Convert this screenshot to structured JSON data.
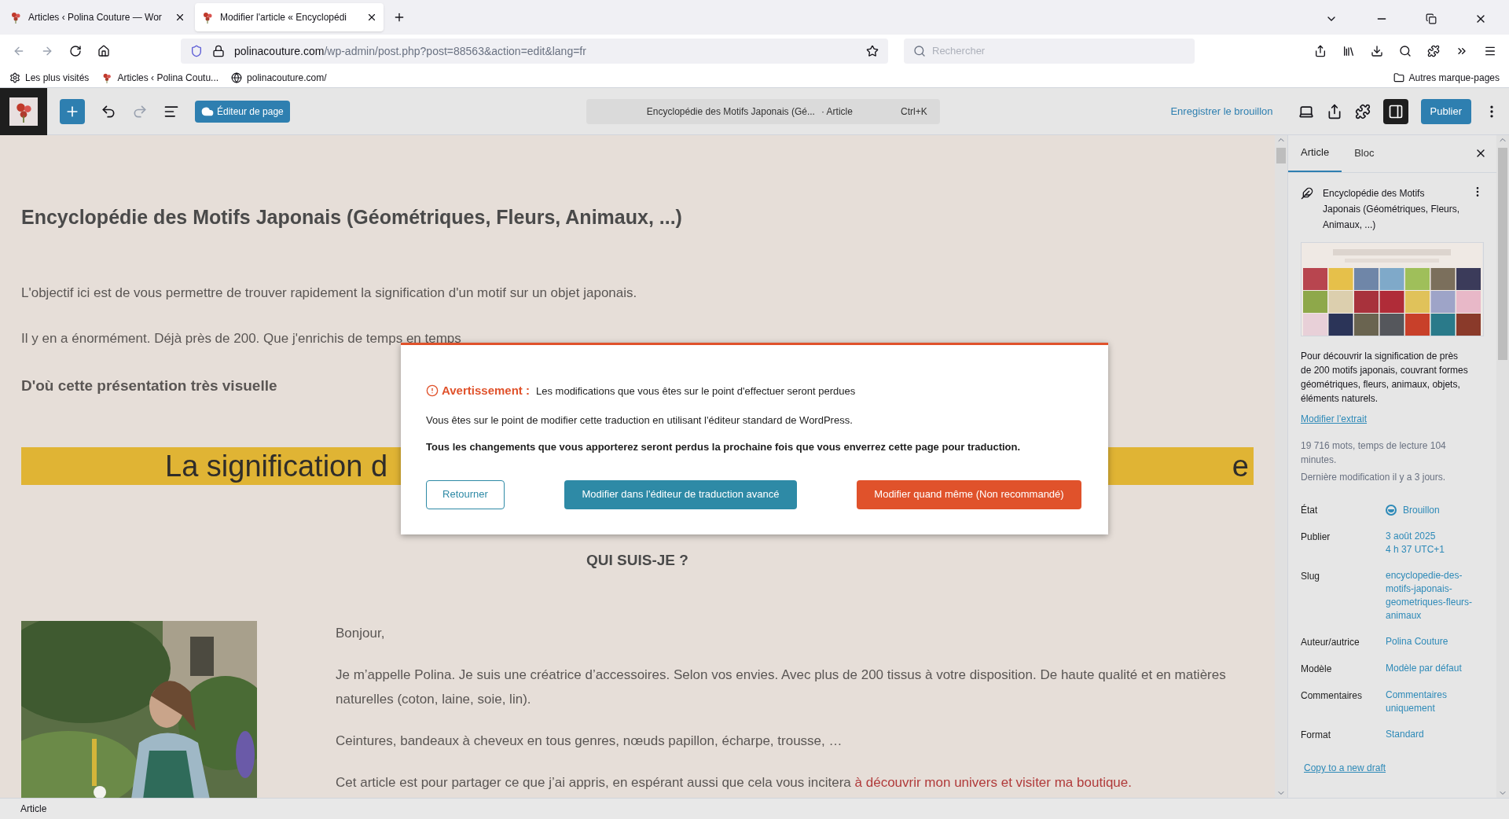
{
  "browser": {
    "tabs": [
      {
        "title": "Articles ‹ Polina Couture — Wor",
        "selected": false
      },
      {
        "title": "Modifier l'article « Encyclopédi",
        "selected": true
      }
    ],
    "url_host": "polinacouture.com",
    "url_path": "/wp-admin/post.php?post=88563&action=edit&lang=fr",
    "search_placeholder": "Rechercher",
    "bookmarks": [
      "Les plus visités",
      "Articles ‹ Polina Coutu...",
      "polinacouture.com/"
    ],
    "other_bookmarks": "Autres marque-pages"
  },
  "toolbar": {
    "editor_button": "Éditeur de page",
    "doc_title": "Encyclopédie des Motifs Japonais (Gé...",
    "doc_type": "· Article",
    "shortcut": "Ctrl+K",
    "save_draft": "Enregistrer le brouillon",
    "publish": "Publier"
  },
  "content": {
    "title": "Encyclopédie des Motifs Japonais (Géométriques, Fleurs, Animaux, ...)",
    "paragraphs": [
      {
        "text": "L'objectif ici est de vous permettre de trouver rapidement la signification d'un motif sur un objet japonais.",
        "bold": false
      },
      {
        "text": "Il y en a énormément. Déjà près de 200. Que j'enrichis de temps en temps",
        "bold": false
      },
      {
        "text": "D'où cette présentation très visuelle",
        "bold": true
      }
    ],
    "banner_left": "La signification d",
    "banner_right": "e",
    "section_heading": "QUI SUIS-JE ?",
    "bio": [
      "Bonjour,",
      "Je m’appelle Polina. Je suis une créatrice d’accessoires. Selon vos envies. Avec plus de 200 tissus à votre disposition. De haute qualité et en matières naturelles (coton, laine, soie, lin).",
      "Ceintures, bandeaux à cheveux en tous genres, nœuds papillon, écharpe, trousse, …"
    ],
    "bio_last": "Cet article est pour partager ce que j’ai appris, en espérant aussi que cela vous incitera ",
    "bio_link": "à découvrir mon univers et visiter ma boutique."
  },
  "sidebar": {
    "tabs": [
      {
        "label": "Article",
        "selected": true
      },
      {
        "label": "Bloc",
        "selected": false
      }
    ],
    "post_title": "Encyclopédie des Motifs Japonais (Géométriques, Fleurs, Animaux, ...)",
    "excerpt": "Pour découvrir la signification de près de 200 motifs japonais, couvrant formes géométriques, fleurs, animaux, objets, éléments naturels.",
    "edit_excerpt": "Modifier l’extrait",
    "stats": "19 716 mots, temps de lecture 104 minutes.",
    "modified": "Dernière modification il y a 3 jours.",
    "fields": [
      {
        "label": "État",
        "value": "Brouillon",
        "kind": "status"
      },
      {
        "label": "Publier",
        "value": "3 août 2025\n4 h 37 UTC+1",
        "kind": "link"
      },
      {
        "label": "Slug",
        "value": "encyclopedie-des-motifs-japonais-geometriques-fleurs-animaux",
        "kind": "link"
      },
      {
        "label": "Auteur/autrice",
        "value": "Polina Couture",
        "kind": "link"
      },
      {
        "label": "Modèle",
        "value": "Modèle par défaut",
        "kind": "link"
      },
      {
        "label": "Commentaires",
        "value": "Commentaires uniquement",
        "kind": "link"
      },
      {
        "label": "Format",
        "value": "Standard",
        "kind": "link"
      }
    ],
    "copy_link": "Copy to a new draft"
  },
  "status_bar": "Article",
  "modal": {
    "warning_label": "Avertissement :",
    "warning_text": "Les modifications que vous êtes sur le point d'effectuer seront perdues",
    "line": "Vous êtes sur le point de modifier cette traduction en utilisant l'éditeur standard de WordPress.",
    "bold_line": "Tous les changements que vous apporterez seront perdus la prochaine fois que vous enverrez cette page pour traduction.",
    "buttons": [
      {
        "label": "Retourner",
        "kind": "outline"
      },
      {
        "label": "Modifier dans l'éditeur de traduction avancé",
        "kind": "primary"
      },
      {
        "label": "Modifier quand même (Non recommandé)",
        "kind": "danger"
      }
    ]
  }
}
